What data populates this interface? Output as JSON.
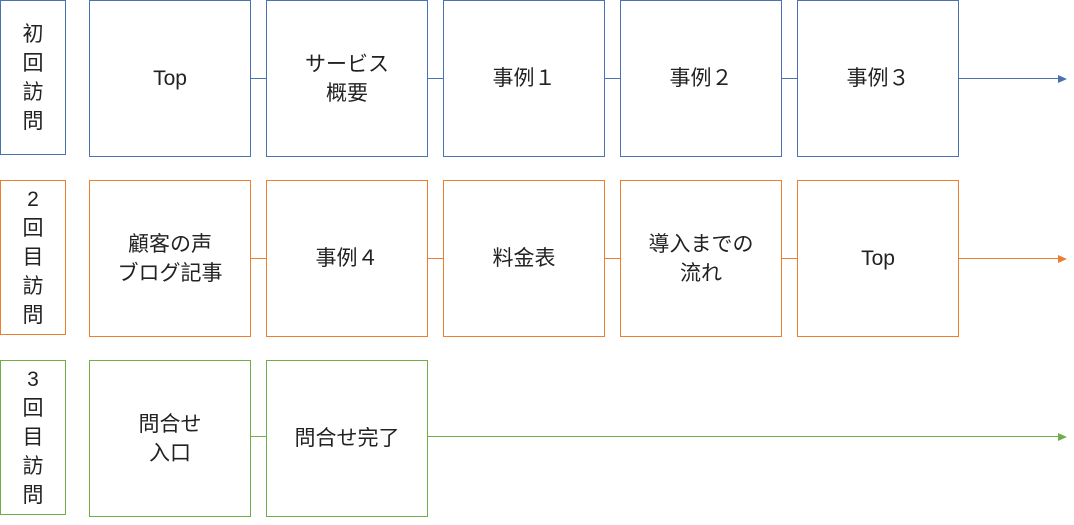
{
  "colors": {
    "visit1": "#4a72b0",
    "visit2": "#ed7d31",
    "visit3": "#70ad47"
  },
  "rows": [
    {
      "label": [
        "初",
        "回",
        "訪",
        "問"
      ],
      "steps": [
        [
          "Top"
        ],
        [
          "サービス",
          "概要"
        ],
        [
          "事例１"
        ],
        [
          "事例２"
        ],
        [
          "事例３"
        ]
      ]
    },
    {
      "label": [
        "2",
        "回",
        "目",
        "訪",
        "問"
      ],
      "steps": [
        [
          "顧客の声",
          "ブログ記事"
        ],
        [
          "事例４"
        ],
        [
          "料金表"
        ],
        [
          "導入までの",
          "流れ"
        ],
        [
          "Top"
        ]
      ]
    },
    {
      "label": [
        "3",
        "回",
        "目",
        "訪",
        "問"
      ],
      "steps": [
        [
          "問合せ",
          "入口"
        ],
        [
          "問合せ完了"
        ]
      ]
    }
  ]
}
